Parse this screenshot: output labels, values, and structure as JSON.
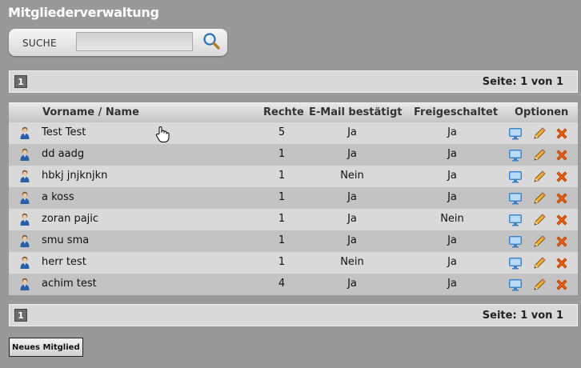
{
  "page": {
    "title": "Mitgliederverwaltung"
  },
  "search": {
    "label": "SUCHE",
    "value": "",
    "placeholder": ""
  },
  "pager_top": {
    "page": "1",
    "info": "Seite: 1 von 1"
  },
  "pager_bottom": {
    "page": "1",
    "info": "Seite: 1 von 1"
  },
  "table": {
    "headers": {
      "name": "Vorname / Name",
      "rechte": "Rechte",
      "mail": "E-Mail bestätigt",
      "frei": "Freigeschaltet",
      "options": "Optionen"
    },
    "rows": [
      {
        "name": "Test Test",
        "rechte": "5",
        "mail": "Ja",
        "frei": "Ja"
      },
      {
        "name": "dd aadg",
        "rechte": "1",
        "mail": "Ja",
        "frei": "Ja"
      },
      {
        "name": "hbkj jnjknjkn",
        "rechte": "1",
        "mail": "Nein",
        "frei": "Ja"
      },
      {
        "name": "a koss",
        "rechte": "1",
        "mail": "Ja",
        "frei": "Ja"
      },
      {
        "name": "zoran pajic",
        "rechte": "1",
        "mail": "Ja",
        "frei": "Nein"
      },
      {
        "name": "smu sma",
        "rechte": "1",
        "mail": "Ja",
        "frei": "Ja"
      },
      {
        "name": "herr test",
        "rechte": "1",
        "mail": "Nein",
        "frei": "Ja"
      },
      {
        "name": "achim test",
        "rechte": "4",
        "mail": "Ja",
        "frei": "Ja"
      }
    ]
  },
  "actions": {
    "new_member": "Neues Mitglied"
  },
  "icons": {
    "user": "user-icon",
    "view": "monitor-icon",
    "edit": "pencil-icon",
    "delete": "delete-x-icon",
    "search": "magnifier-icon"
  },
  "colors": {
    "background": "#999999",
    "row_light": "#d9d9d9",
    "row_dark": "#c3c3c3",
    "delete": "#e8580c"
  }
}
